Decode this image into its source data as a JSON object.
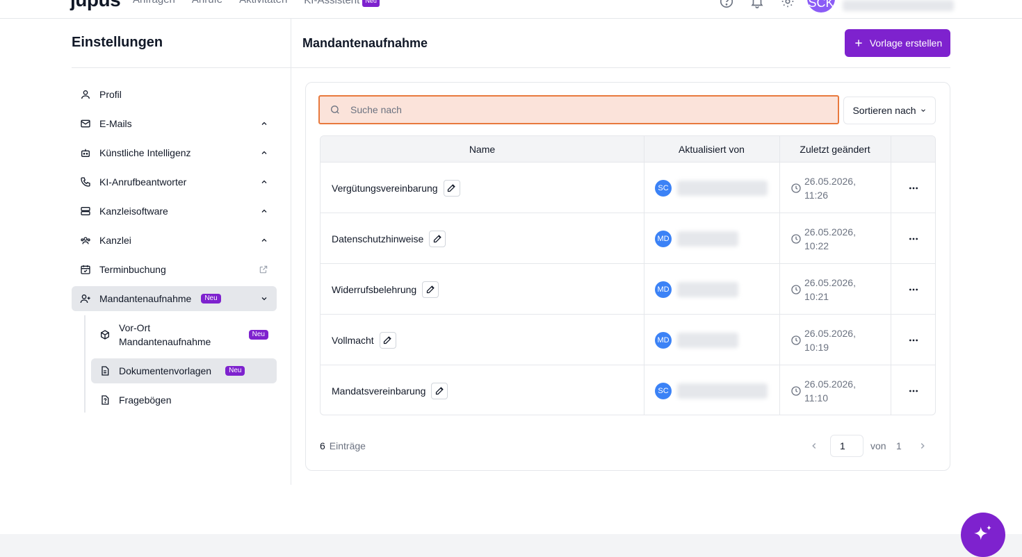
{
  "topbar": {
    "logo": "jupus",
    "nav": [
      "Anfragen",
      "Anrufe",
      "Aktivitäten",
      "KI-Assistent"
    ],
    "ki_badge": "Neu",
    "avatar_initials": "SCK"
  },
  "sidebar": {
    "title": "Einstellungen",
    "items": [
      {
        "label": "Profil"
      },
      {
        "label": "E-Mails"
      },
      {
        "label": "Künstliche Intelligenz"
      },
      {
        "label": "KI-Anrufbeantworter"
      },
      {
        "label": "Kanzleisoftware"
      },
      {
        "label": "Kanzlei"
      },
      {
        "label": "Terminbuchung"
      },
      {
        "label": "Mandantenaufnahme",
        "badge": "Neu"
      }
    ],
    "subitems": [
      {
        "label": "Vor-Ort Mandantenaufnahme",
        "badge": "Neu"
      },
      {
        "label": "Dokumentenvorlagen",
        "badge": "Neu"
      },
      {
        "label": "Fragebögen"
      }
    ]
  },
  "content": {
    "title": "Mandantenaufnahme",
    "create_button": "Vorlage erstellen",
    "search_placeholder": "Suche nach",
    "sort_label": "Sortieren nach",
    "columns": [
      "Name",
      "Aktualisiert von",
      "Zuletzt geändert"
    ],
    "rows": [
      {
        "name": "Vergütungsvereinbarung",
        "initials": "SC",
        "date": "26.05.2026,",
        "time": "11:26"
      },
      {
        "name": "Datenschutzhinweise",
        "initials": "MD",
        "date": "26.05.2026,",
        "time": "10:22"
      },
      {
        "name": "Widerrufsbelehrung",
        "initials": "MD",
        "date": "26.05.2026,",
        "time": "10:21"
      },
      {
        "name": "Vollmacht",
        "initials": "MD",
        "date": "26.05.2026,",
        "time": "10:19"
      },
      {
        "name": "Mandatsvereinbarung",
        "initials": "SC",
        "date": "26.05.2026,",
        "time": "11:10"
      }
    ],
    "entries_count": "6",
    "entries_label": "Einträge",
    "page_current": "1",
    "page_of": "von",
    "page_total": "1"
  },
  "colors": {
    "accent": "#7e22ce",
    "avatar_blue": "#3b82f6",
    "search_bg": "#fbe3da",
    "search_border": "#e8793d"
  },
  "icons": [
    "help-icon",
    "bell-icon",
    "gear-icon",
    "user-icon",
    "mail-icon",
    "robot-icon",
    "phone-icon",
    "server-icon",
    "users-icon",
    "calendar-icon",
    "external-link-icon",
    "user-plus-icon",
    "box-icon",
    "document-icon",
    "file-question-icon",
    "plus-icon",
    "search-icon",
    "chevron-down-icon",
    "pencil-icon",
    "clock-icon",
    "more-icon",
    "sparkle-icon"
  ]
}
